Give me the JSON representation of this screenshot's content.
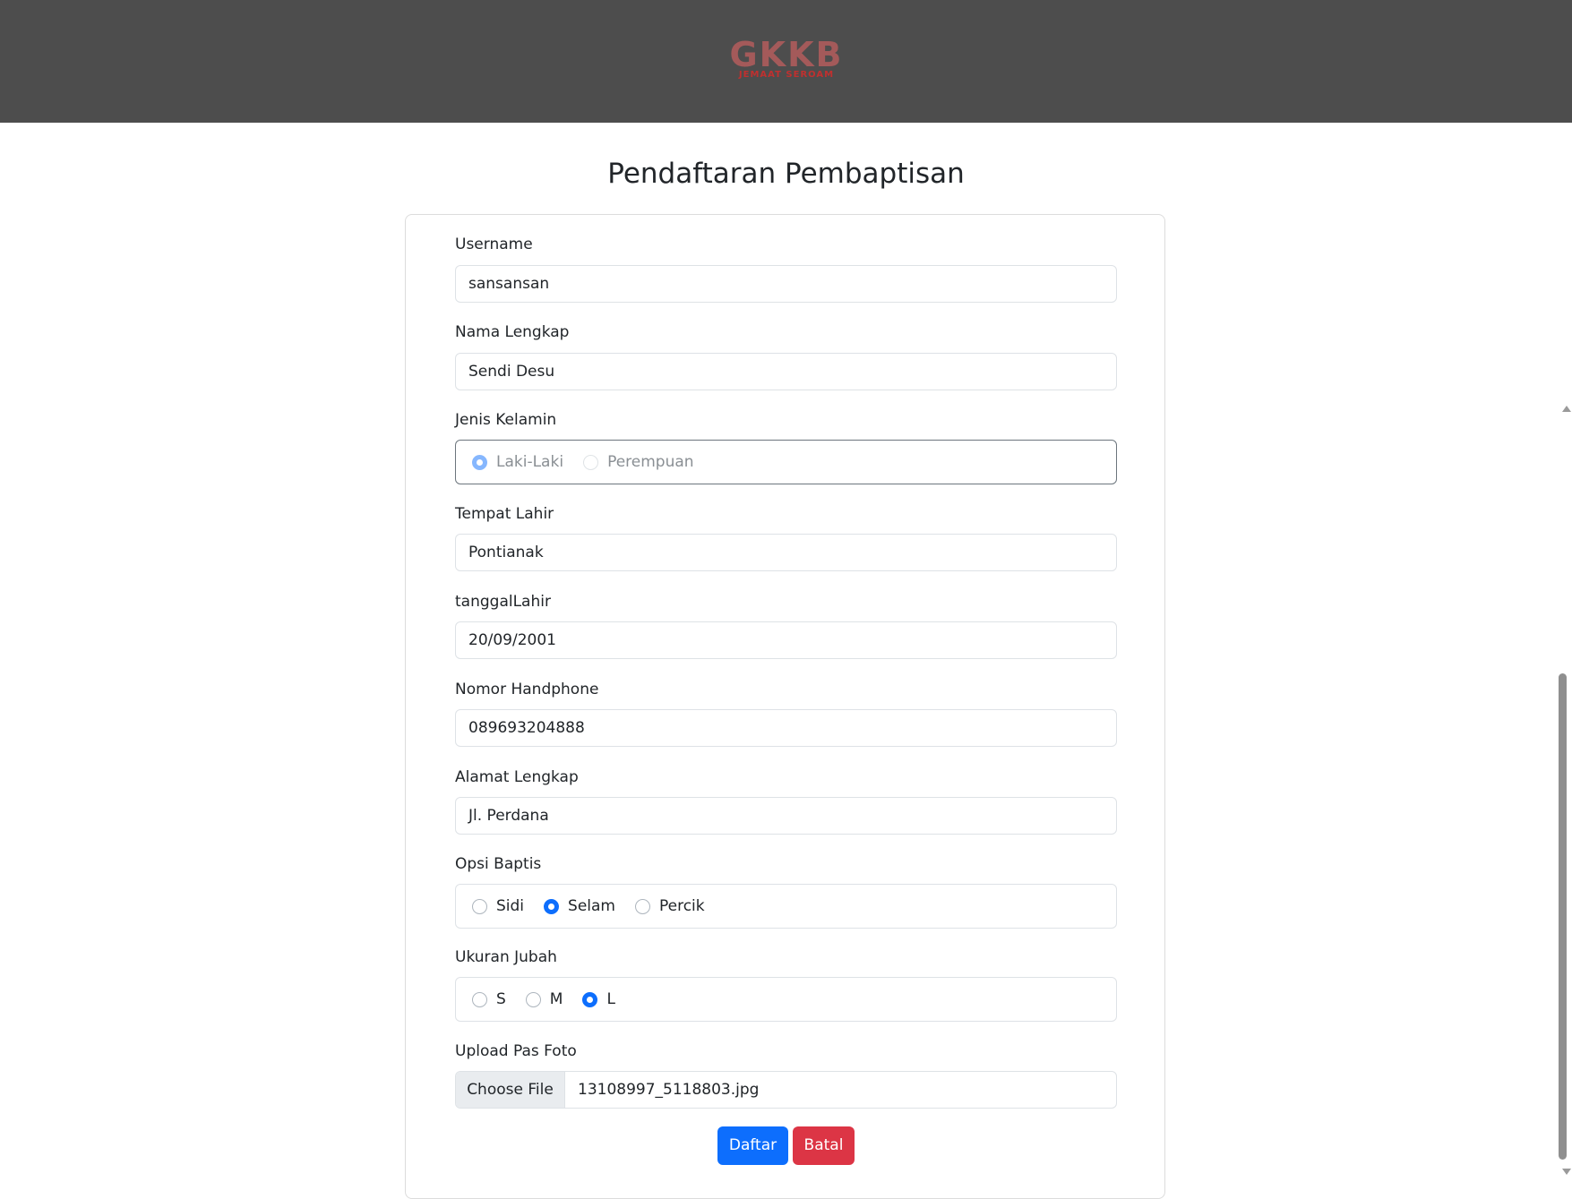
{
  "header": {
    "logo_main": "GKKB",
    "logo_sub": "JEMAAT SEROAM"
  },
  "page": {
    "title": "Pendaftaran Pembaptisan"
  },
  "form": {
    "username": {
      "label": "Username",
      "value": "sansansan"
    },
    "nama_lengkap": {
      "label": "Nama Lengkap",
      "value": "Sendi Desu"
    },
    "jenis_kelamin": {
      "label": "Jenis Kelamin",
      "options": [
        "Laki-Laki",
        "Perempuan"
      ],
      "selected": "Laki-Laki",
      "disabled": true
    },
    "tempat_lahir": {
      "label": "Tempat Lahir",
      "value": "Pontianak"
    },
    "tanggal_lahir": {
      "label": "tanggalLahir",
      "value": "20/09/2001"
    },
    "nomor_handphone": {
      "label": "Nomor Handphone",
      "value": "089693204888"
    },
    "alamat_lengkap": {
      "label": "Alamat Lengkap",
      "value": "Jl. Perdana"
    },
    "opsi_baptis": {
      "label": "Opsi Baptis",
      "options": [
        "Sidi",
        "Selam",
        "Percik"
      ],
      "selected": "Selam"
    },
    "ukuran_jubah": {
      "label": "Ukuran Jubah",
      "options": [
        "S",
        "M",
        "L"
      ],
      "selected": "L"
    },
    "upload_pas_foto": {
      "label": "Upload Pas Foto",
      "button_label": "Choose File",
      "file_name": "13108997_5118803.jpg"
    }
  },
  "buttons": {
    "submit_label": "Daftar",
    "cancel_label": "Batal"
  },
  "colors": {
    "header_bg": "#4d4d4d",
    "primary": "#0d6efd",
    "danger": "#dc3545"
  }
}
